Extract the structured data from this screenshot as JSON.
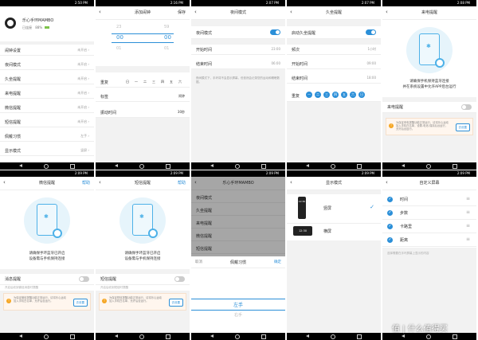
{
  "colors": {
    "accent": "#2b8fd8",
    "warn": "#f5a623"
  },
  "status_times": [
    "2:50 PM",
    "2:16 PM",
    "2:07 PM",
    "2:07 PM",
    "2:08 PM",
    "2:09 PM",
    "2:09 PM",
    "2:09 PM",
    "2:09 PM",
    "2:09 PM"
  ],
  "p1": {
    "device": "乐心手环MAMBO",
    "connected": "已连接",
    "battery": "88%",
    "items": [
      {
        "label": "闹钟设置",
        "value": "未开启"
      },
      {
        "label": "夜间模式",
        "value": "未开启"
      },
      {
        "label": "久坐提醒",
        "value": "未开启"
      },
      {
        "label": "来电提醒",
        "value": "未开启"
      },
      {
        "label": "微信提醒",
        "value": "未开启"
      },
      {
        "label": "短信提醒",
        "value": "未开启"
      },
      {
        "label": "佩戴习惯",
        "value": "左手"
      },
      {
        "label": "显示模式",
        "value": "竖屏"
      }
    ]
  },
  "p2": {
    "title": "添加闹钟",
    "save": "保存",
    "hours": [
      "",
      "00",
      ""
    ],
    "minutes": [
      "",
      "00",
      ""
    ],
    "hours_side": [
      "23",
      "01"
    ],
    "mins_side": [
      "59",
      "01"
    ],
    "repeat": "重复",
    "weekdays": [
      "日",
      "一",
      "二",
      "三",
      "四",
      "五",
      "六"
    ],
    "label": "标签",
    "label_value": "闹钟",
    "vibrate": "振动时间",
    "vibrate_value": "30秒"
  },
  "p3": {
    "title": "夜间模式",
    "items": [
      {
        "label": "夜间模式"
      },
      {
        "label": "开始时间",
        "value": "23:00"
      },
      {
        "label": "结束时间",
        "value": "06:00"
      }
    ],
    "note": "夜间模式下，手环将不会显示屏幕，但依然会记录您的运动和睡眠数据。"
  },
  "p4": {
    "title": "久坐提醒",
    "enable": "启动久坐提醒",
    "items": [
      {
        "label": "频次",
        "value": "1小时"
      },
      {
        "label": "开始时间",
        "value": "09:00"
      },
      {
        "label": "结束时间",
        "value": "18:00"
      }
    ],
    "repeat": "重复",
    "days": [
      "一",
      "二",
      "三",
      "四",
      "五",
      "六",
      "日"
    ]
  },
  "p5": {
    "title": "来电提醒",
    "msg1": "请确保手机保持蓝牙连接",
    "msg2": "并在系统设置中允许APP后台运行",
    "row": "来电提醒",
    "note": "为保证来电提醒功能正常运行，请将乐心运动加入手机白名单，设置-电池-保持后台运行，允许后台运行。",
    "btn": "去设置"
  },
  "p6": {
    "title": "微信提醒",
    "action": "帮助",
    "msg1": "请确保手环蓝牙已开启",
    "msg2": "设备需与手机保持连接",
    "row": "消息提醒",
    "sub": "开启后收到微信消息时提醒",
    "note": "为保证微信提醒功能正常运行，请将乐心运动加入手机白名单，允许后台运行。",
    "btn": "去设置"
  },
  "p7": {
    "title": "短信提醒",
    "action": "帮助",
    "msg1": "请确保手环蓝牙已开启",
    "msg2": "设备需与手机保持连接",
    "row": "短信提醒",
    "sub": "开启后收到短信时提醒",
    "note": "为保证短信提醒功能正常运行，请将乐心运动加入手机白名单，允许后台运行。",
    "btn": "去设置"
  },
  "p8": {
    "device": "乐心手环MAMBO",
    "sheet_title": "佩戴习惯",
    "cancel": "取消",
    "ok": "确定",
    "options": [
      "左手",
      "右手"
    ]
  },
  "p9": {
    "title": "显示模式",
    "options": [
      {
        "label": "竖屏",
        "time": "12:30"
      },
      {
        "label": "横屏",
        "time": "12:30"
      }
    ]
  },
  "p10": {
    "title": "自定义屏幕",
    "items": [
      "时间",
      "步数",
      "卡路里",
      "距离"
    ],
    "note": "选择需要在手环屏幕上显示的内容"
  },
  "watermark": {
    "text": "值 | 什么值得买"
  }
}
